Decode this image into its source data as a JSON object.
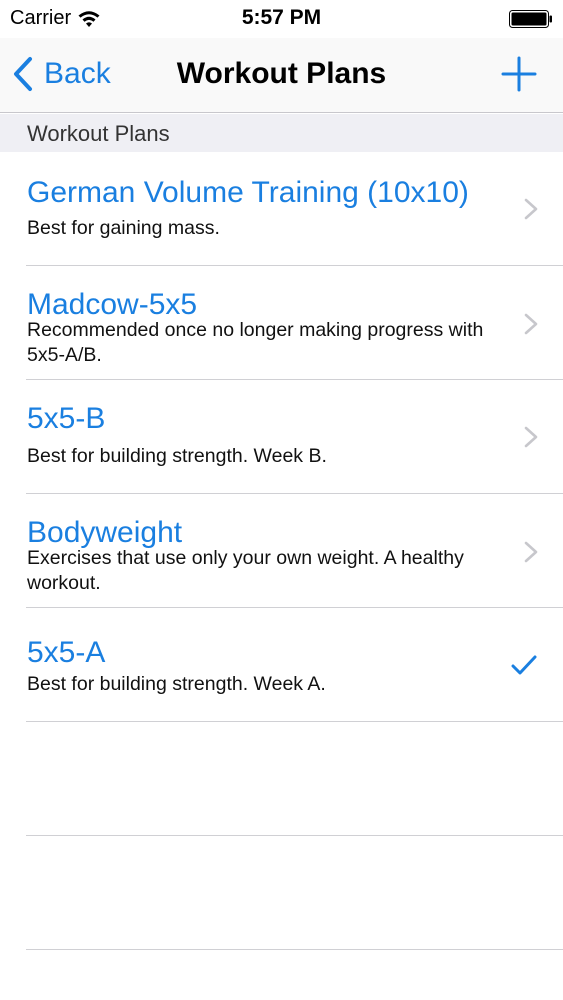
{
  "status_bar": {
    "carrier": "Carrier",
    "time": "5:57 PM"
  },
  "nav": {
    "back_label": "Back",
    "title": "Workout Plans"
  },
  "section": {
    "header": "Workout Plans"
  },
  "plans": [
    {
      "title": "German Volume Training (10x10)",
      "subtitle": "Best for gaining mass.",
      "accessory": "chevron"
    },
    {
      "title": "Madcow-5x5",
      "subtitle": "Recommended once no longer making progress with 5x5-A/B.",
      "accessory": "chevron"
    },
    {
      "title": "5x5-B",
      "subtitle": "Best for building strength. Week B.",
      "accessory": "chevron"
    },
    {
      "title": "Bodyweight",
      "subtitle": "Exercises that use only your own weight.  A healthy workout.",
      "accessory": "chevron"
    },
    {
      "title": "5x5-A",
      "subtitle": "Best for building strength. Week A.",
      "accessory": "checkmark"
    }
  ],
  "colors": {
    "accent": "#1a7fe0",
    "separator": "#d0d0d4",
    "section_bg": "#efeff4"
  }
}
